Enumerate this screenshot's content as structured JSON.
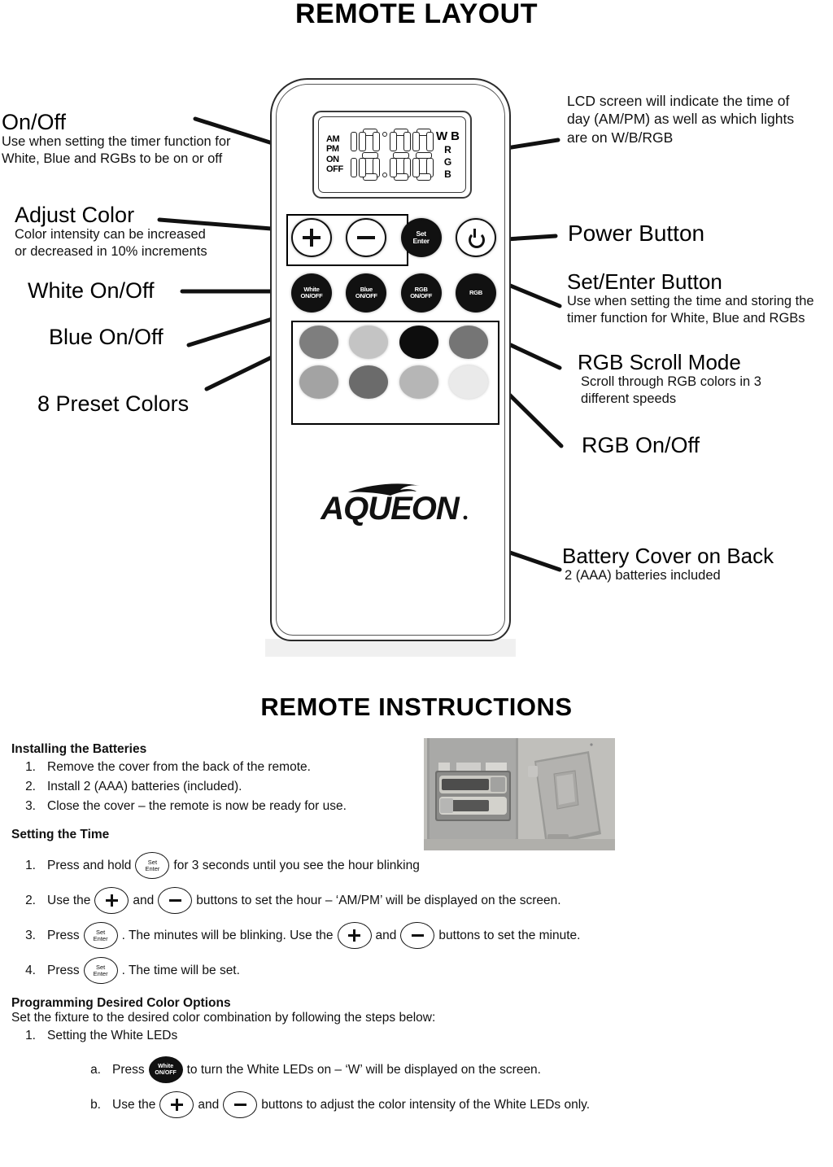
{
  "headings": {
    "layout": "REMOTE LAYOUT",
    "instructions": "REMOTE INSTRUCTIONS"
  },
  "annotations": {
    "on_off": {
      "title": "On/Off",
      "line1": "Use when setting the timer function for",
      "line2": "White, Blue and RGBs to be on or off"
    },
    "adjust_color": {
      "title": "Adjust Color",
      "line1": "Color intensity can be increased",
      "line2": "or decreased in 10% increments"
    },
    "white_on_off": {
      "title": "White On/Off"
    },
    "blue_on_off": {
      "title": "Blue On/Off"
    },
    "preset_colors": {
      "title": "8 Preset Colors"
    },
    "lcd_screen": {
      "line1": "LCD screen will indicate the time of",
      "line2": "day (AM/PM) as well as which lights",
      "line3": "are on W/B/RGB"
    },
    "power_button": {
      "title": "Power Button"
    },
    "set_enter": {
      "title": "Set/Enter Button",
      "line1": "Use when setting the time and storing the",
      "line2": "timer function for White, Blue and RGBs"
    },
    "rgb_scroll": {
      "title": "RGB Scroll Mode",
      "line1": "Scroll through RGB colors in 3",
      "line2": "different speeds"
    },
    "rgb_on_off": {
      "title": "RGB On/Off"
    },
    "battery_cover": {
      "title": "Battery Cover on Back",
      "line1": "2 (AAA) batteries included"
    }
  },
  "remote": {
    "lcd": {
      "left_labels": [
        "AM",
        "PM",
        "ON",
        "OFF"
      ],
      "right_top": [
        "W",
        "B"
      ],
      "right_col": [
        "R",
        "G",
        "B"
      ]
    },
    "buttons_row1": [
      {
        "name": "plus",
        "label": "",
        "glyph": "plus"
      },
      {
        "name": "minus",
        "label": "",
        "glyph": "minus"
      },
      {
        "name": "set-enter",
        "line1": "Set",
        "line2": "Enter",
        "glyph": "text"
      },
      {
        "name": "power",
        "label": "",
        "glyph": "power"
      }
    ],
    "buttons_row2": [
      {
        "name": "white-on-off",
        "line1": "White",
        "line2": "ON/OFF"
      },
      {
        "name": "blue-on-off",
        "line1": "Blue",
        "line2": "ON/OFF"
      },
      {
        "name": "rgb-on-off",
        "line1": "RGB",
        "line2": "ON/OFF"
      },
      {
        "name": "rgb-scroll",
        "line1": "RGB",
        "line2": ""
      }
    ],
    "preset_colors": [
      "#7e7e7e",
      "#c4c4c4",
      "#0d0d0d",
      "#757575",
      "#a3a3a3",
      "#6b6b6b",
      "#b6b6b6",
      "#eaeaea"
    ],
    "brand": "AQUEON"
  },
  "instructions": {
    "batteries": {
      "heading": "Installing the Batteries",
      "steps": [
        {
          "num": "1.",
          "text": "Remove the cover from the back of the remote."
        },
        {
          "num": "2.",
          "text": "Install 2 (AAA) batteries (included)."
        },
        {
          "num": "3.",
          "text": "Close the cover – the remote is now be ready for use."
        }
      ]
    },
    "time": {
      "heading": "Setting the Time",
      "steps": [
        {
          "num": "1.",
          "pre": "Press and hold",
          "post": "for 3 seconds until you see the hour blinking"
        },
        {
          "num": "2.",
          "pre": "Use the",
          "mid": "and",
          "post": "buttons to set the hour – ‘AM/PM’ will be displayed on the screen."
        },
        {
          "num": "3.",
          "pre": "Press",
          "mid": ". The minutes will be blinking. Use the",
          "mid2": "and",
          "post": "buttons to set the minute."
        },
        {
          "num": "4.",
          "pre": "Press",
          "post": ". The time will be set."
        }
      ]
    },
    "color_options": {
      "heading": "Programming Desired Color Options",
      "intro": "Set the fixture to the desired color combination by following the steps below:",
      "step1": {
        "num": "1.",
        "text": "Setting the White LEDs"
      },
      "sub_a": {
        "num": "a.",
        "pre": "Press",
        "post": "to turn the White LEDs on – ‘W’ will be displayed on the screen."
      },
      "sub_b": {
        "num": "b.",
        "pre": "Use the",
        "mid": "and",
        "post": "buttons to adjust the color intensity of the White LEDs only."
      }
    },
    "icons": {
      "set_enter_l1": "Set",
      "set_enter_l2": "Enter",
      "white_l1": "White",
      "white_l2": "ON/OFF"
    }
  }
}
